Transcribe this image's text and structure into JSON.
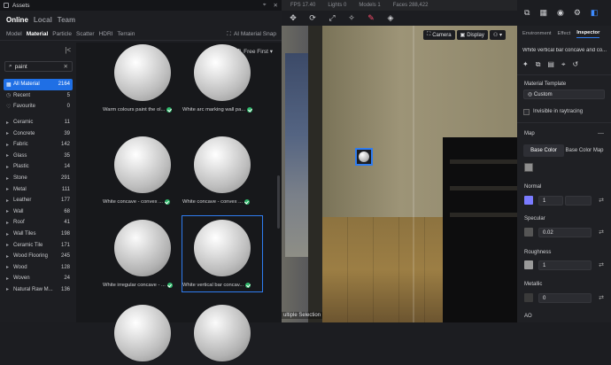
{
  "assets": {
    "title": "Assets",
    "library_tabs": [
      "Online",
      "Local",
      "Team"
    ],
    "category_tabs": [
      "Model",
      "Material",
      "Particle",
      "Scatter",
      "HDRI",
      "Terrain"
    ],
    "snap_label": "AI Material Snap",
    "search_value": "paint",
    "sort_label": "Free First",
    "sidebar": [
      {
        "label": "All Material",
        "count": "2164",
        "icon": "grid-icon"
      },
      {
        "label": "Recent",
        "count": "5",
        "icon": "clock-icon"
      },
      {
        "label": "Favourite",
        "count": "0",
        "icon": "heart-icon"
      },
      {
        "label": "Ceramic",
        "count": "11"
      },
      {
        "label": "Concrete",
        "count": "39"
      },
      {
        "label": "Fabric",
        "count": "142"
      },
      {
        "label": "Glass",
        "count": "35"
      },
      {
        "label": "Plastic",
        "count": "14"
      },
      {
        "label": "Stone",
        "count": "291"
      },
      {
        "label": "Metal",
        "count": "111"
      },
      {
        "label": "Leather",
        "count": "177"
      },
      {
        "label": "Wall",
        "count": "68"
      },
      {
        "label": "Roof",
        "count": "41"
      },
      {
        "label": "Wall Tiles",
        "count": "198"
      },
      {
        "label": "Ceramic Tile",
        "count": "171"
      },
      {
        "label": "Wood Flooring",
        "count": "245"
      },
      {
        "label": "Wood",
        "count": "128"
      },
      {
        "label": "Woven",
        "count": "24"
      },
      {
        "label": "Natural Raw M...",
        "count": "136"
      }
    ],
    "cards": [
      {
        "name": "Warm colours paint the ol..."
      },
      {
        "name": "White arc marking wall pa..."
      },
      {
        "name": "White concave - convex ..."
      },
      {
        "name": "White concave - convex ..."
      },
      {
        "name": "White irregular concave - ..."
      },
      {
        "name": "White vertical bar concav..."
      },
      {
        "name": ""
      },
      {
        "name": ""
      }
    ]
  },
  "viewport": {
    "stats": [
      "FPS 17.40",
      "Lights 0",
      "Models 1",
      "Faces 288,422"
    ],
    "camera_label": "Camera",
    "display_label": "Display",
    "status": "ultiple Selection"
  },
  "inspector": {
    "tabs": [
      "Environment",
      "Effect",
      "Inspector"
    ],
    "material_name": "White vertical bar concave and co...",
    "template_label": "Material Template",
    "template_value": "Custom",
    "invisible_label": "Invisible in raytracing",
    "map_label": "Map",
    "map_tabs": [
      "Base Color",
      "Base Color Map"
    ],
    "normal_label": "Normal",
    "normal_value": "1",
    "specular_label": "Specular",
    "specular_value": "0.02",
    "roughness_label": "Roughness",
    "roughness_value": "1",
    "metallic_label": "Metallic",
    "metallic_value": "0",
    "ao_label": "AO"
  },
  "colors": {
    "accent": "#1f6fe5",
    "ok": "#2fb86b",
    "normal_swatch": "#7a7bff"
  }
}
